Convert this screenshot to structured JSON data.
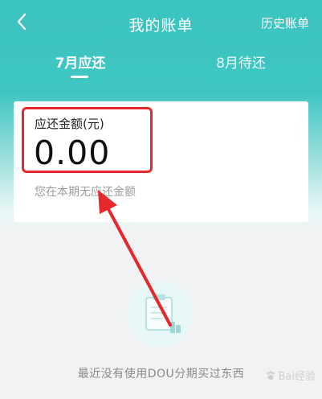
{
  "header": {
    "title": "我的账单",
    "history_label": "历史账单",
    "back_icon": "chevron-left-icon"
  },
  "tabs": [
    {
      "label": "7月应还",
      "active": true
    },
    {
      "label": "8月待还",
      "active": false
    }
  ],
  "bill_card": {
    "amount_label": "应还金额(元)",
    "amount_value": "0.00",
    "note": "您在本期无应还金额"
  },
  "empty_state": {
    "icon": "clipboard-icon",
    "message": "最近没有使用DOU分期买过东西"
  },
  "watermark": {
    "text": "Bai经验",
    "icon": "paw-icon"
  },
  "colors": {
    "primary": "#3cc4c1",
    "annotation": "#e4282b",
    "background": "#f1f2f4"
  }
}
